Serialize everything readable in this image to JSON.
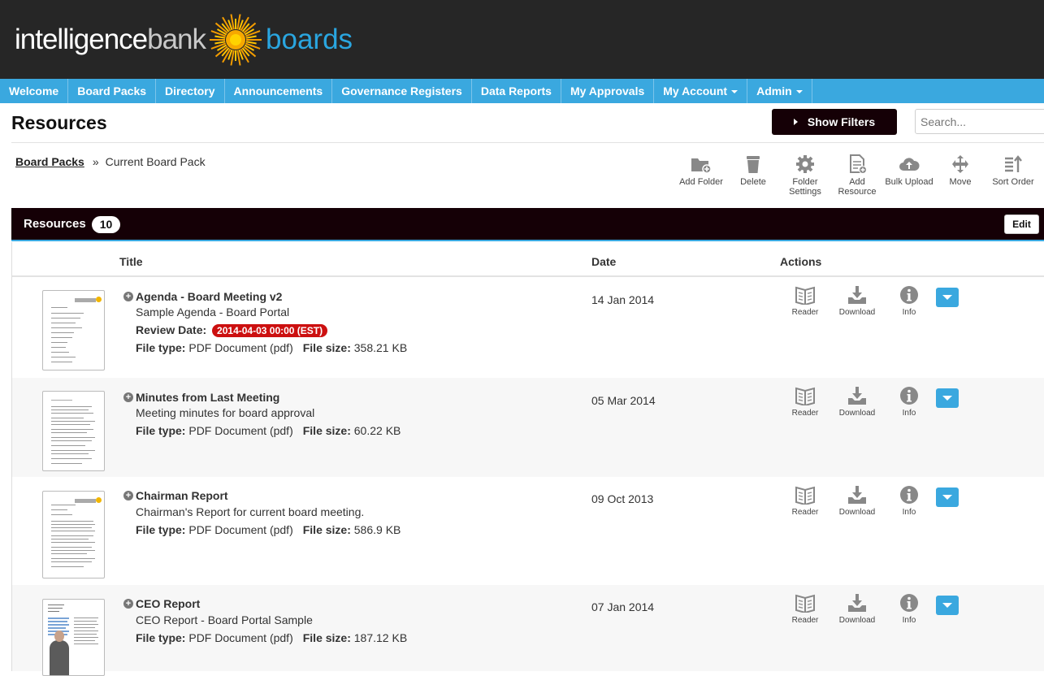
{
  "brand": {
    "word1": "intelligence",
    "word2": "bank",
    "word3": "boards"
  },
  "nav": [
    {
      "label": "Welcome",
      "caret": false
    },
    {
      "label": "Board Packs",
      "caret": false
    },
    {
      "label": "Directory",
      "caret": false
    },
    {
      "label": "Announcements",
      "caret": false
    },
    {
      "label": "Governance Registers",
      "caret": false
    },
    {
      "label": "Data Reports",
      "caret": false
    },
    {
      "label": "My Approvals",
      "caret": false
    },
    {
      "label": "My Account",
      "caret": true
    },
    {
      "label": "Admin",
      "caret": true
    }
  ],
  "page": {
    "title": "Resources",
    "show_filters": "Show Filters",
    "search_placeholder": "Search..."
  },
  "breadcrumb": {
    "root": "Board Packs",
    "separator": "»",
    "current": "Current Board Pack"
  },
  "toolbar": [
    {
      "icon": "add-folder-icon",
      "label": "Add Folder"
    },
    {
      "icon": "trash-icon",
      "label": "Delete"
    },
    {
      "icon": "gear-icon",
      "label": "Folder Settings"
    },
    {
      "icon": "add-document-icon",
      "label": "Add Resource"
    },
    {
      "icon": "cloud-upload-icon",
      "label": "Bulk Upload"
    },
    {
      "icon": "move-icon",
      "label": "Move"
    },
    {
      "icon": "sort-order-icon",
      "label": "Sort Order"
    }
  ],
  "panel": {
    "title": "Resources",
    "count": "10",
    "edit": "Edit"
  },
  "columns": {
    "title": "Title",
    "date": "Date",
    "actions": "Actions"
  },
  "action_labels": {
    "reader": "Reader",
    "download": "Download",
    "info": "Info"
  },
  "labels": {
    "review_date": "Review Date:",
    "file_type": "File type:",
    "file_size": "File size:"
  },
  "resources": [
    {
      "title": "Agenda - Board Meeting v2",
      "description": "Sample Agenda - Board Portal",
      "review_date": "2014-04-03 00:00 (EST)",
      "file_type": "PDF Document (pdf)",
      "file_size": "358.21 KB",
      "date": "14 Jan 2014"
    },
    {
      "title": "Minutes from Last Meeting",
      "description": "Meeting minutes for board approval",
      "file_type": "PDF Document (pdf)",
      "file_size": "60.22 KB",
      "date": "05 Mar 2014"
    },
    {
      "title": "Chairman Report",
      "description": "Chairman's Report for current board meeting.",
      "file_type": "PDF Document (pdf)",
      "file_size": "586.9 KB",
      "date": "09 Oct 2013"
    },
    {
      "title": "CEO Report",
      "description": "CEO Report - Board Portal Sample",
      "file_type": "PDF Document (pdf)",
      "file_size": "187.12 KB",
      "date": "07 Jan 2014"
    }
  ],
  "colors": {
    "nav": "#3aa8df",
    "header": "#262626",
    "panel": "#150006",
    "review_badge": "#cc1010"
  }
}
